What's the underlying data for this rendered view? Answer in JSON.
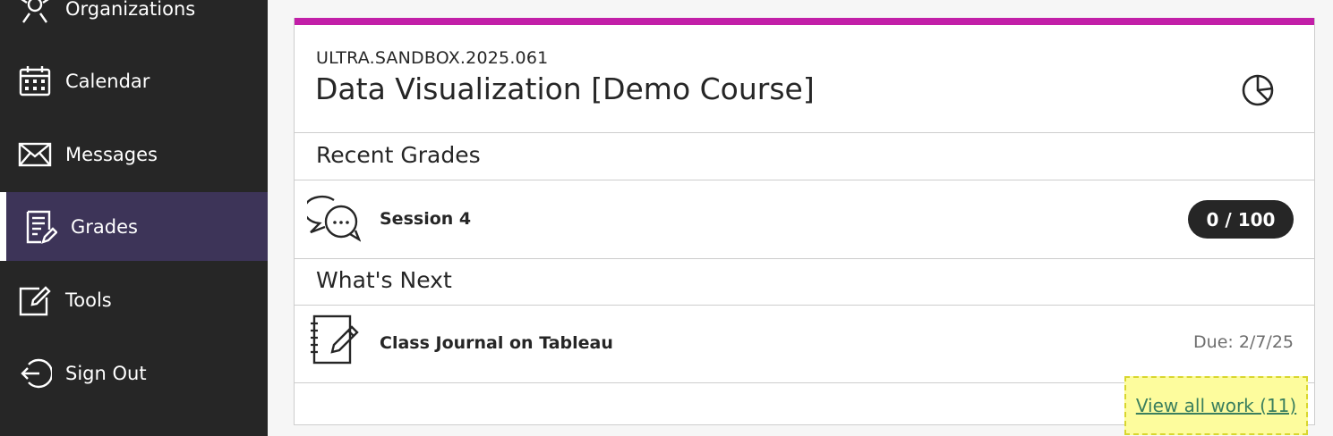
{
  "sidebar": {
    "items": [
      {
        "label": "Organizations",
        "icon": "organizations-icon"
      },
      {
        "label": "Calendar",
        "icon": "calendar-icon"
      },
      {
        "label": "Messages",
        "icon": "envelope-icon"
      },
      {
        "label": "Grades",
        "icon": "grades-icon",
        "active": true
      },
      {
        "label": "Tools",
        "icon": "tools-icon"
      },
      {
        "label": "Sign Out",
        "icon": "sign-out-icon"
      }
    ]
  },
  "course": {
    "code": "ULTRA.SANDBOX.2025.061",
    "title": "Data Visualization [Demo Course]",
    "accent_color": "#c21fa8",
    "recent_grades": {
      "heading": "Recent Grades",
      "items": [
        {
          "title": "Session 4",
          "grade": "0 / 100",
          "icon": "discussion-icon"
        }
      ]
    },
    "whats_next": {
      "heading": "What's Next",
      "items": [
        {
          "title": "Class Journal on Tableau",
          "due": "Due: 2/7/25",
          "icon": "journal-icon"
        }
      ]
    },
    "view_all_label": "View all work (11)"
  },
  "colors": {
    "sidebar_bg": "#262626",
    "active_bg": "#3d3458",
    "link": "#3b7f5e",
    "highlight": "#fdfc9d"
  }
}
